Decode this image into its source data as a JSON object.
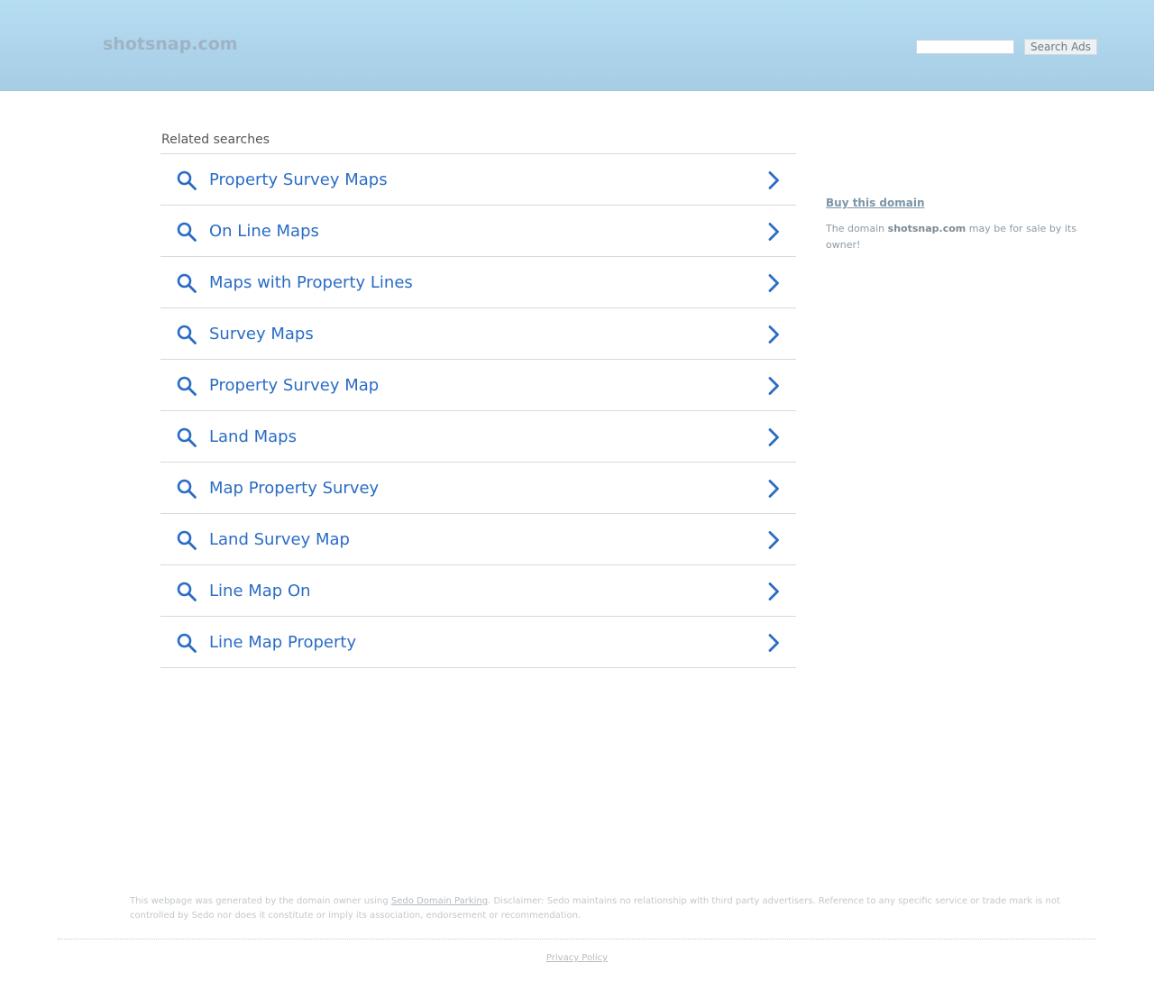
{
  "header": {
    "logo_text": "shotsnap.com",
    "search": {
      "value": "",
      "placeholder": "",
      "button_label": "Search Ads"
    }
  },
  "related": {
    "title": "Related searches",
    "items": [
      {
        "label": "Property Survey Maps"
      },
      {
        "label": "On Line Maps"
      },
      {
        "label": "Maps with Property Lines"
      },
      {
        "label": "Survey Maps"
      },
      {
        "label": "Property Survey Map"
      },
      {
        "label": "Land Maps"
      },
      {
        "label": "Map Property Survey"
      },
      {
        "label": "Land Survey Map"
      },
      {
        "label": "Line Map On"
      },
      {
        "label": "Line Map Property"
      }
    ]
  },
  "sidebar": {
    "buy_link": "Buy this domain",
    "text_before": "The domain ",
    "domain": "shotsnap.com",
    "text_after": " may be for sale by its owner!"
  },
  "footer": {
    "disclaimer_before": "This webpage was generated by the domain owner using ",
    "disclaimer_link": "Sedo Domain Parking",
    "disclaimer_after": ". Disclaimer: Sedo maintains no relationship with third party advertisers. Reference to any specific service or trade mark is not controlled by Sedo nor does it constitute or imply its association, endorsement or recommendation.",
    "privacy_label": "Privacy Policy"
  },
  "colors": {
    "header_gradient_top": "#b6def3",
    "header_gradient_bottom": "#a6cde4",
    "link_blue": "#2a6cc4",
    "divider": "#d9d9d9"
  },
  "icons": {
    "result_left": "search-icon",
    "result_right": "chevron-right-icon"
  }
}
